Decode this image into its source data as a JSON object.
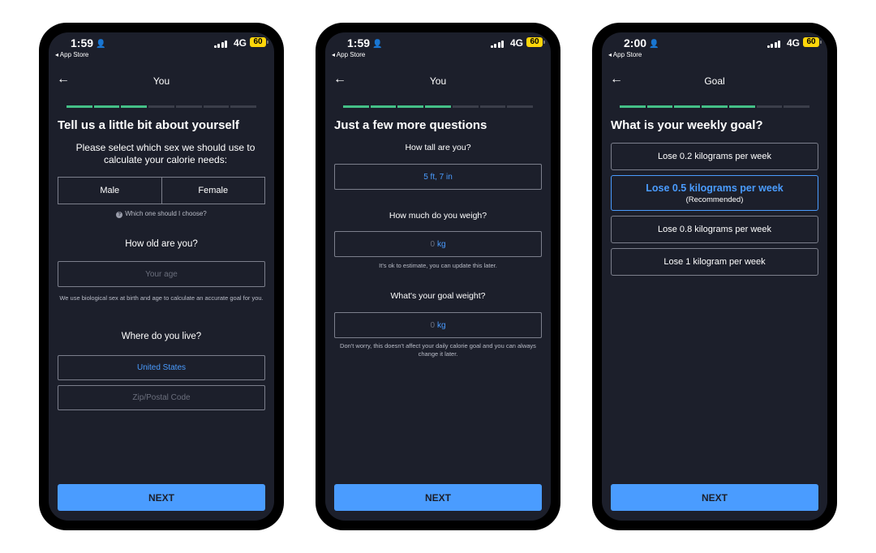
{
  "screens": [
    {
      "status": {
        "time": "1:59",
        "app_store": "◂ App Store",
        "network": "4G",
        "battery": "60"
      },
      "nav_title": "You",
      "heading": "Tell us a little bit about yourself",
      "sex_question": "Please select which sex we should use to calculate your calorie needs:",
      "sex_options": [
        "Male",
        "Female"
      ],
      "sex_help": "Which one should I choose?",
      "age_question": "How old are you?",
      "age_placeholder": "Your age",
      "age_note": "We use biological sex at birth and age to calculate an accurate goal for you.",
      "location_question": "Where do you live?",
      "country": "United States",
      "zip_placeholder": "Zip/Postal Code",
      "next_label": "NEXT",
      "progress_done": 3,
      "progress_total": 7
    },
    {
      "status": {
        "time": "1:59",
        "app_store": "◂ App Store",
        "network": "4G",
        "battery": "60"
      },
      "nav_title": "You",
      "heading": "Just a few more questions",
      "height_question": "How tall are you?",
      "height_value": "5 ft, 7 in",
      "weight_question": "How much do you weigh?",
      "weight_value": "0",
      "weight_unit": "kg",
      "weight_note": "It's ok to estimate, you can update this later.",
      "goal_weight_question": "What's your goal weight?",
      "goal_weight_value": "0",
      "goal_weight_unit": "kg",
      "goal_weight_note": "Don't worry, this doesn't affect your daily calorie goal and you can always change it later.",
      "next_label": "NEXT",
      "progress_done": 4,
      "progress_total": 7
    },
    {
      "status": {
        "time": "2:00",
        "app_store": "◂ App Store",
        "network": "4G",
        "battery": "60"
      },
      "nav_title": "Goal",
      "heading": "What is your weekly goal?",
      "options": [
        {
          "label": "Lose 0.2 kilograms per week",
          "sub": ""
        },
        {
          "label": "Lose 0.5 kilograms per week",
          "sub": "(Recommended)"
        },
        {
          "label": "Lose 0.8 kilograms per week",
          "sub": ""
        },
        {
          "label": "Lose 1 kilogram per week",
          "sub": ""
        }
      ],
      "selected_option": 1,
      "next_label": "NEXT",
      "progress_done": 5,
      "progress_total": 7
    }
  ],
  "colors": {
    "screen_bg": "#1c1f2b",
    "accent": "#4a9cff",
    "progress": "#44c087",
    "border": "#7c7f8c"
  },
  "icons": {
    "back": "arrow-left-icon",
    "person": "person-icon",
    "help": "question-circle-icon"
  }
}
